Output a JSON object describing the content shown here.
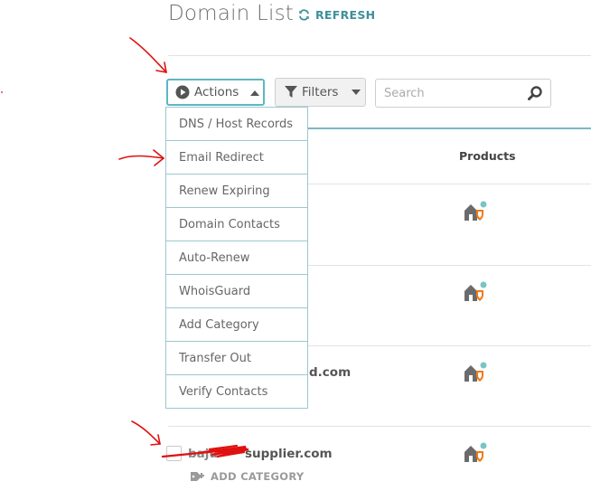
{
  "header": {
    "title": "Domain List",
    "refresh_label": "REFRESH"
  },
  "toolbar": {
    "actions_label": "Actions",
    "filters_label": "Filters",
    "search_placeholder": "Search"
  },
  "table": {
    "products_header": "Products"
  },
  "actions_menu": {
    "items": [
      "DNS / Host Records",
      "Email Redirect",
      "Renew Expiring",
      "Domain Contacts",
      "Auto-Renew",
      "WhoisGuard",
      "Add Category",
      "Transfer Out",
      "Verify Contacts"
    ]
  },
  "rows": {
    "row3_domain_tail": "d.com",
    "row4_domain_visible": "supplier.com",
    "add_category_label": "ADD CATEGORY"
  },
  "colors": {
    "accent": "#3e8f9b",
    "menu_border": "#9cc7cf",
    "annotation_red": "#e01010"
  },
  "icons": [
    "refresh-icon",
    "play-circle-icon",
    "caret-up-icon",
    "funnel-icon",
    "caret-down-icon",
    "magnifier-icon",
    "hosting-shield-icon",
    "tag-plus-icon"
  ]
}
